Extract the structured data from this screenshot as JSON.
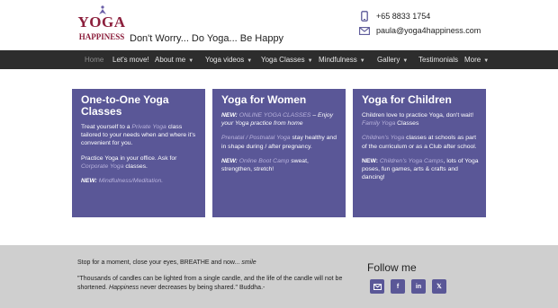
{
  "header": {
    "logo_top": "YOGA",
    "logo_bottom": "HAPPINESS",
    "tagline": "Don't Worry... Do Yoga... Be Happy",
    "phone": "+65 8833 1754",
    "email": "paula@yoga4happiness.com"
  },
  "nav": {
    "items": [
      {
        "label": "Home",
        "active": true
      },
      {
        "label": "Let's move!"
      },
      {
        "label": "About me"
      },
      {
        "label": "Yoga videos"
      },
      {
        "label": "Yoga Classes"
      },
      {
        "label": "Mindfulness"
      },
      {
        "label": "Gallery"
      },
      {
        "label": "Testimonials"
      },
      {
        "label": "More"
      }
    ]
  },
  "cards": [
    {
      "title": "One-to-One Yoga Classes",
      "p1_pre": "Treat yourself to a ",
      "p1_link": "Private Yoga",
      "p1_post": " class tailored to your needs when and where it's convenient for you.",
      "p2_pre": "Practice Yoga in your office. Ask for ",
      "p2_link": "Corporate Yoga",
      "p2_post": " classes.",
      "p3_new": "NEW:",
      "p3_link": "Mindfulness/Meditation."
    },
    {
      "title": "Yoga for Women",
      "p1_new": "NEW:",
      "p1_link": "ONLINE YOGA CLASSES",
      "p1_post": " – Enjoy your Yoga practice from home",
      "p2_link": "Prenatal / Postnatal Yoga",
      "p2_post": " stay healthy and in shape during / after pregnancy.",
      "p3_new": "NEW:",
      "p3_link": "Online Boot Camp",
      "p3_post": " sweat, strengthen, stretch!"
    },
    {
      "title": "Yoga for Children",
      "p1_pre": "Children love to practice Yoga, don't wait! ",
      "p1_link": "Family Yoga",
      "p1_post": " Classes",
      "p2_link": "Children's Yoga",
      "p2_post": " classes at schools as part of the curriculum or as a Club after school.",
      "p3_new": "NEW:",
      "p3_link": "Children's Yoga Camps",
      "p3_post": ", lots of Yoga poses, fun games, arts & crafts and dancing!"
    }
  ],
  "footer": {
    "quote1_pre": "Stop for a moment, close your eyes, BREATHE and now... ",
    "quote1_em": "smile",
    "quote2_pre": "\"Thousands of candles can be lighted from a single candle, and the life of the candle will not be shortened. ",
    "quote2_em": "Happiness",
    "quote2_post": " never decreases by being shared.\" Buddha.-",
    "follow": "Follow me",
    "social": [
      "email-icon",
      "facebook-icon",
      "linkedin-icon",
      "x-icon"
    ]
  },
  "colors": {
    "accent": "#5a5797",
    "logo": "#8c1f3c",
    "nav_bg": "#2d2d2d",
    "footer_bg": "#cfcfcf"
  }
}
